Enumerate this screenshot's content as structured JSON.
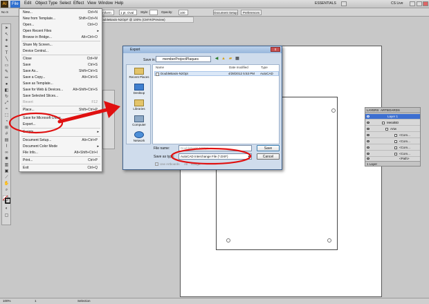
{
  "app": {
    "logo": "Ai",
    "workspace": "ESSENTIALS",
    "cs_live": "CS Live"
  },
  "menubar": {
    "items": [
      "File",
      "Edit",
      "Object",
      "Type",
      "Select",
      "Effect",
      "View",
      "Window",
      "Help"
    ],
    "active": "File"
  },
  "control_bar": {
    "stroke_weight": "1 pt. Oval",
    "style_label": "Style:",
    "opacity_label": "Opacity:",
    "opacity_value": "100",
    "document_setup": "Document Setup",
    "preferences": "Preferences",
    "brush_field": "Uniform",
    "no_selection": "No S"
  },
  "document_tab": {
    "title": "DoubleBasis-N2Opt* @ 100% (CMYK/Preview)"
  },
  "file_menu": {
    "items": [
      {
        "label": "New...",
        "shortcut": "Ctrl+N"
      },
      {
        "label": "New from Template...",
        "shortcut": "Shift+Ctrl+N"
      },
      {
        "label": "Open...",
        "shortcut": "Ctrl+O"
      },
      {
        "label": "Open Recent Files",
        "shortcut": "▸"
      },
      {
        "label": "Browse in Bridge...",
        "shortcut": "Alt+Ctrl+O"
      },
      {
        "label": "Share My Screen...",
        "shortcut": ""
      },
      {
        "label": "Device Central...",
        "shortcut": ""
      },
      {
        "label": "Close",
        "shortcut": "Ctrl+W"
      },
      {
        "label": "Save",
        "shortcut": "Ctrl+S"
      },
      {
        "label": "Save As...",
        "shortcut": "Shift+Ctrl+S"
      },
      {
        "label": "Save a Copy...",
        "shortcut": "Alt+Ctrl+S"
      },
      {
        "label": "Save as Template...",
        "shortcut": ""
      },
      {
        "label": "Save for Web & Devices...",
        "shortcut": "Alt+Shift+Ctrl+S"
      },
      {
        "label": "Save Selected Slices...",
        "shortcut": ""
      },
      {
        "label": "Revert",
        "shortcut": "F12",
        "disabled": true
      },
      {
        "label": "Place...",
        "shortcut": "Shift+Ctrl+P"
      },
      {
        "label": "Save for Microsoft Office...",
        "shortcut": ""
      },
      {
        "label": "Export...",
        "shortcut": ""
      },
      {
        "label": "Scripts",
        "shortcut": "▸"
      },
      {
        "label": "Document Setup...",
        "shortcut": "Alt+Ctrl+P"
      },
      {
        "label": "Document Color Mode",
        "shortcut": "▸"
      },
      {
        "label": "File Info...",
        "shortcut": "Alt+Shift+Ctrl+I"
      },
      {
        "label": "Print...",
        "shortcut": "Ctrl+P"
      },
      {
        "label": "Exit",
        "shortcut": "Ctrl+Q"
      }
    ]
  },
  "export_dialog": {
    "title": "Export",
    "save_in_label": "Save in:",
    "save_in_value": "memberProjectPlaques",
    "places": [
      "Recent Places",
      "Desktop",
      "Libraries",
      "Computer",
      "Network"
    ],
    "columns": [
      "Name",
      "Date modified",
      "Type"
    ],
    "files": [
      {
        "name": "DoubleBasis-N2Opt",
        "date": "4/28/2012 5:53 PM",
        "type": "AutoCAD"
      }
    ],
    "file_name_label": "File name:",
    "file_name_value": "DoubleBasis-N2Opt",
    "save_type_label": "Save as type:",
    "save_type_value": "AutoCAD Interchange File (*.DXF)",
    "save_button": "Save",
    "cancel_button": "Cancel",
    "use_artboards": "Use Artboards",
    "all_label": "All",
    "range_label": "Range:",
    "close_glyph": "x"
  },
  "layers_panel": {
    "tabs": [
      "LAYERS",
      "ARTBOARDS"
    ],
    "rows": [
      "Layer 1",
      "MetalBD",
      "Artw",
      "<Com...",
      "<Com...",
      "<Com...",
      "<Com...",
      "<Path>"
    ],
    "footer": "1 Layer"
  },
  "status_bar": {
    "zoom": "100%",
    "page": "1",
    "tool": "Selection"
  },
  "colors": {
    "highlight": "#2e6fce",
    "annotation_red": "#e01010",
    "dialog_chrome": "#cfdcec"
  }
}
